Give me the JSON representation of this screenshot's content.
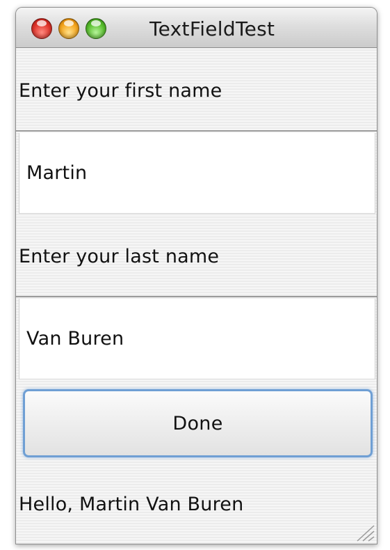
{
  "window": {
    "title": "TextFieldTest",
    "controls": {
      "close_icon": "close-icon",
      "minimize_icon": "minimize-icon",
      "zoom_icon": "zoom-icon"
    }
  },
  "form": {
    "first_name_label": "Enter your first name",
    "first_name_value": "Martin",
    "last_name_label": "Enter your last name",
    "last_name_value": "Van Buren",
    "done_label": "Done"
  },
  "output": {
    "greeting": "Hello, Martin Van Buren"
  },
  "colors": {
    "close": "#e0342b",
    "minimize": "#f5a51c",
    "zoom": "#58bf2d",
    "focus_ring": "#6f9fd4"
  }
}
